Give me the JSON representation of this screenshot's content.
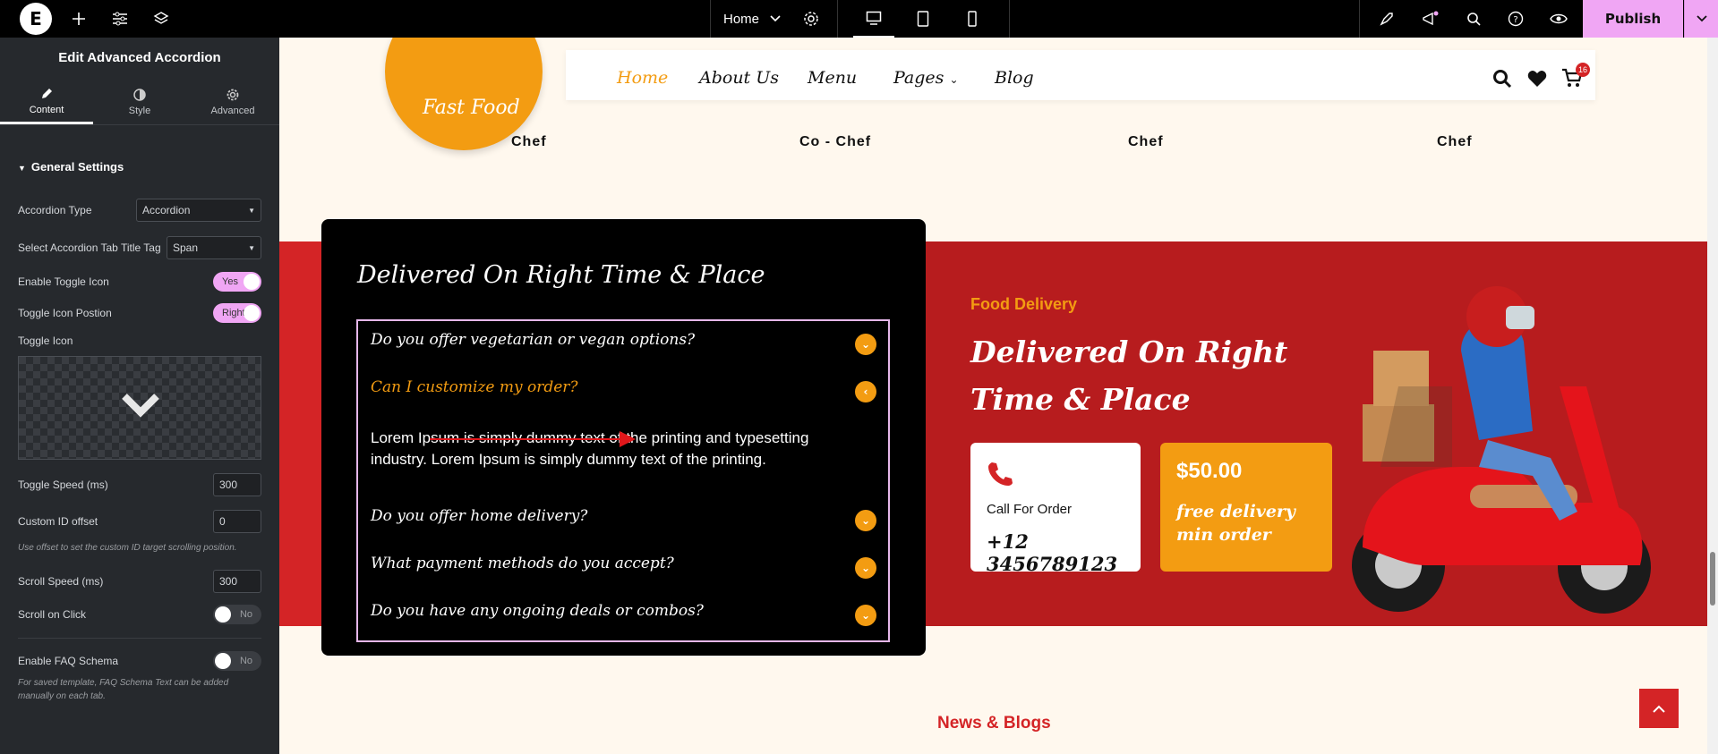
{
  "topbar": {
    "logo": "E",
    "page_select": "Home",
    "publish_label": "Publish",
    "icons": [
      "plus-icon",
      "sliders-icon",
      "layers-icon",
      "chevron-down-icon",
      "gear-icon",
      "desktop-icon",
      "tablet-icon",
      "mobile-icon",
      "rocket-icon",
      "megaphone-icon",
      "search-icon",
      "help-icon",
      "eye-icon"
    ]
  },
  "panel": {
    "title": "Edit Advanced Accordion",
    "tabs": [
      {
        "label": "Content"
      },
      {
        "label": "Style"
      },
      {
        "label": "Advanced"
      }
    ],
    "section": "General Settings",
    "accordion_type": {
      "label": "Accordion Type",
      "value": "Accordion"
    },
    "title_tag": {
      "label": "Select Accordion Tab Title Tag",
      "value": "Span"
    },
    "enable_toggle": {
      "label": "Enable Toggle Icon",
      "value": "Yes"
    },
    "toggle_position": {
      "label": "Toggle Icon Postion",
      "value": "Right"
    },
    "toggle_icon": {
      "label": "Toggle Icon"
    },
    "toggle_speed": {
      "label": "Toggle Speed (ms)",
      "value": "300"
    },
    "custom_id": {
      "label": "Custom ID offset",
      "value": "0"
    },
    "custom_id_note": "Use offset to set the custom ID target scrolling position.",
    "scroll_speed": {
      "label": "Scroll Speed (ms)",
      "value": "300"
    },
    "scroll_click": {
      "label": "Scroll on Click",
      "value": "No"
    },
    "faq_schema": {
      "label": "Enable FAQ Schema",
      "value": "No"
    },
    "faq_note": "For saved template, FAQ Schema Text can be added manually on each tab."
  },
  "site": {
    "logo_text": "Fast Food",
    "nav": [
      "Home",
      "About Us",
      "Menu",
      "Pages",
      "Blog"
    ],
    "cart_count": "16",
    "chefs": [
      "Chef",
      "Co - Chef",
      "Chef",
      "Chef"
    ],
    "accordion_title": "Delivered On Right Time & Place",
    "accordion_items": [
      {
        "title": "Do you offer vegetarian or vegan options?",
        "active": false
      },
      {
        "title": "Can I customize my order?",
        "active": true
      },
      {
        "title": "Do you offer home delivery?",
        "active": false
      },
      {
        "title": "What payment methods do you accept?",
        "active": false
      },
      {
        "title": "Do you have any ongoing deals or combos?",
        "active": false
      }
    ],
    "accordion_body": "Lorem Ipsum is simply dummy text of the printing and typesetting industry. Lorem Ipsum is simply dummy text of the printing.",
    "fd_label": "Food Delivery",
    "fd_title": "Delivered On Right Time & Place",
    "call_label": "Call For Order",
    "phone": "+12 3456789123",
    "price": "$50.00",
    "price_note": "free delivery min order",
    "news_title": "News & Blogs"
  },
  "colors": {
    "accent": "#f39c12",
    "red": "#d42426",
    "pink": "#f0a6f4",
    "panel": "#26292d"
  }
}
